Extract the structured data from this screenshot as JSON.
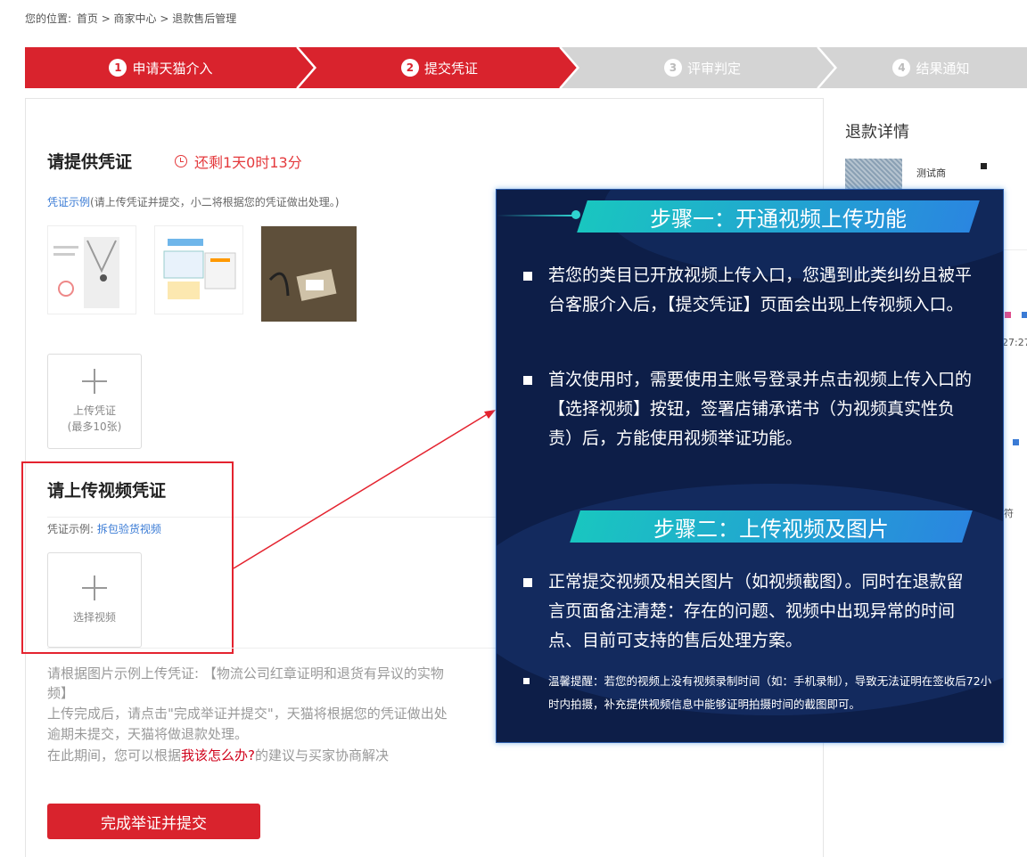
{
  "breadcrumb": {
    "label": "您的位置:",
    "path": "首页 > 商家中心 > 退款售后管理"
  },
  "steps": [
    {
      "num": "1",
      "label": "申请天猫介入",
      "state": "done"
    },
    {
      "num": "2",
      "label": "提交凭证",
      "state": "current"
    },
    {
      "num": "3",
      "label": "评审判定",
      "state": "todo"
    },
    {
      "num": "4",
      "label": "结果通知",
      "state": "todo"
    }
  ],
  "evidence": {
    "title": "请提供凭证",
    "countdown": "还剩1天0时13分",
    "hint_link": "凭证示例",
    "hint_text": "(请上传凭证并提交，小二将根据您的凭证做出处理。)",
    "upload_label": "上传凭证",
    "upload_limit": "(最多10张)"
  },
  "video": {
    "title": "请上传视频凭证",
    "hint_prefix": "凭证示例:",
    "hint_link": "拆包验货视频",
    "select_label": "选择视频"
  },
  "info": {
    "line1": "请根据图片示例上传凭证: 【物流公司红章证明和退货有异议的实物",
    "line1b": "频】",
    "line2": "上传完成后，请点击\"完成举证并提交\"，天猫将根据您的凭证做出处",
    "line3": "逾期未提交，天猫将做退款处理。",
    "line4_prefix": "在此期间，您可以根据",
    "line4_link": "我该怎么办?",
    "line4_suffix": "的建议与买家协商解决"
  },
  "submit_label": "完成举证并提交",
  "right_panel": {
    "title": "退款详情",
    "item_name": "测试商",
    "misc1": "27:27",
    "misc2": "符"
  },
  "overlay": {
    "step1_title": "步骤一：开通视频上传功能",
    "step1_items": [
      "若您的类目已开放视频上传入口，您遇到此类纠纷且被平台客服介入后，【提交凭证】页面会出现上传视频入口。",
      "首次使用时，需要使用主账号登录并点击视频上传入口的【选择视频】按钮，签署店铺承诺书（为视频真实性负责）后，方能使用视频举证功能。"
    ],
    "step2_title": "步骤二：上传视频及图片",
    "step2_items": [
      "正常提交视频及相关图片（如视频截图）。同时在退款留言页面备注清楚：存在的问题、视频中出现异常的时间点、目前可支持的售后处理方案。"
    ],
    "tip": "温馨提醒：若您的视频上没有视频录制时间（如：手机录制），导致无法证明在签收后72小时内拍摄，补充提供视频信息中能够证明拍摄时间的截图即可。"
  },
  "colors": {
    "brand_red": "#d9232d",
    "step_gray": "#d4d4d4",
    "overlay_bg": "#0d1e48",
    "accent_teal": "#19c6c0",
    "link_blue": "#3a7bd5"
  }
}
